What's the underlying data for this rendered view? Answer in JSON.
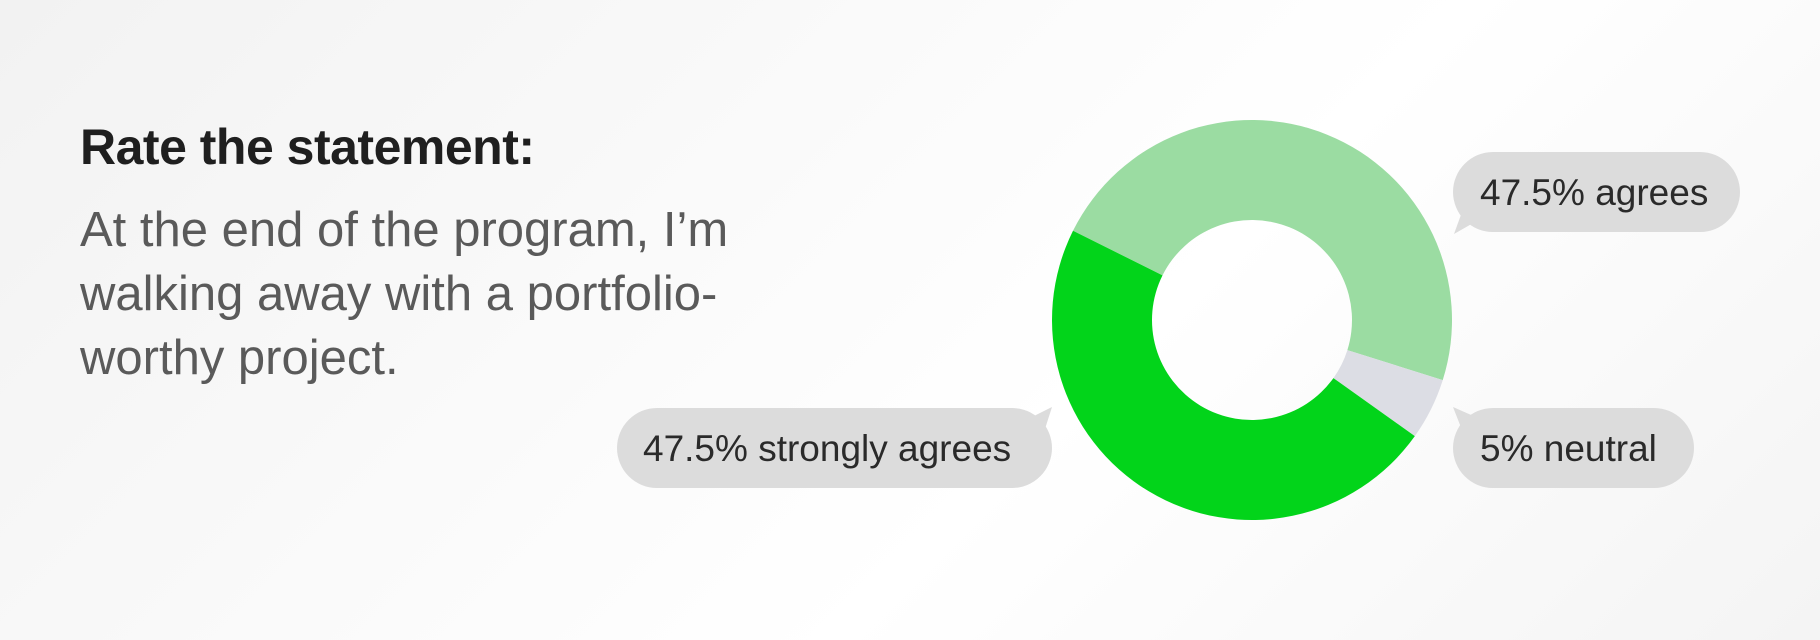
{
  "question": {
    "title": "Rate the statement:",
    "statement": "At the end of the program, I’m walking away with a portfolio-worthy project."
  },
  "chart_data": {
    "type": "pie",
    "style": "donut",
    "slices": [
      {
        "label": "agrees",
        "value": 47.5,
        "color": "#9bdca2",
        "callout": "47.5% agrees"
      },
      {
        "label": "neutral",
        "value": 5,
        "color": "#dcdde4",
        "callout": "5% neutral"
      },
      {
        "label": "strongly agrees",
        "value": 47.5,
        "color": "#02d41a",
        "callout": "47.5% strongly agrees"
      }
    ],
    "legend": "none",
    "callout_color": "#dcdcdc"
  }
}
